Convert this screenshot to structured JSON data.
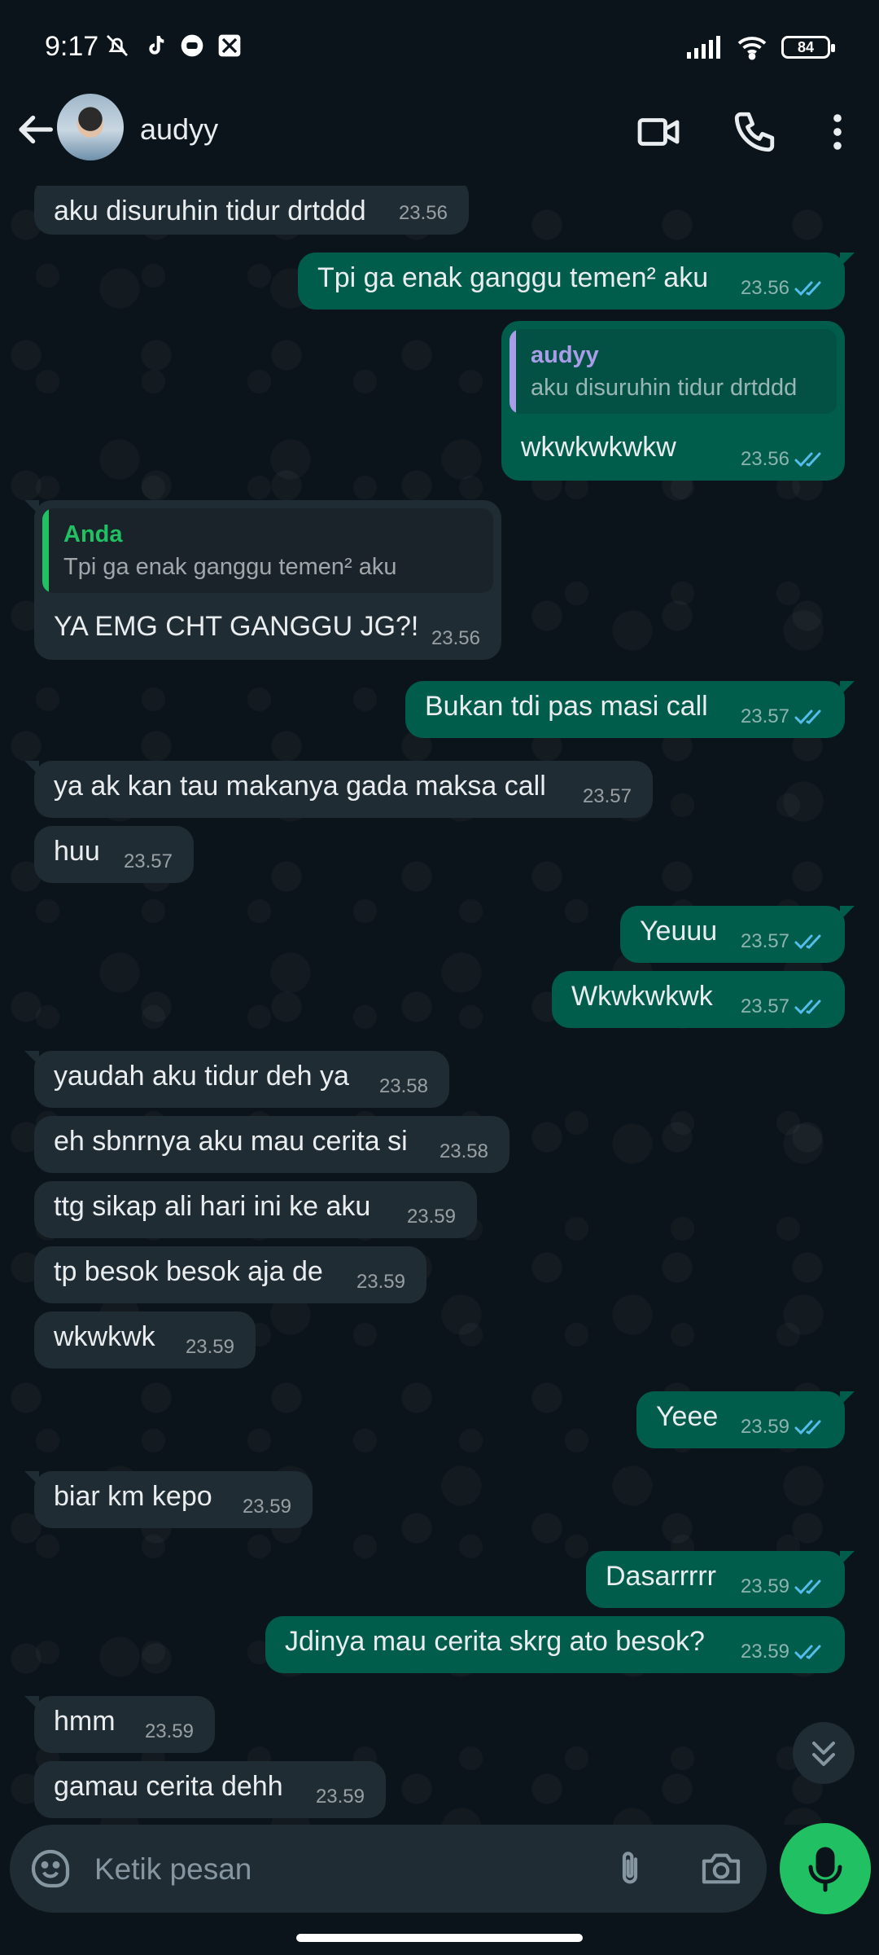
{
  "status_bar": {
    "time": "9:17",
    "battery": "84"
  },
  "header": {
    "contact_name": "audyy"
  },
  "messages": [
    {
      "text": "aku disuruhin tidur drtddd",
      "time": "23.56"
    },
    {
      "text": "Tpi ga enak ganggu temen² aku",
      "time": "23.56"
    },
    {
      "quote_author": "audyy",
      "quote_text": "aku disuruhin tidur drtddd",
      "text": "wkwkwkwkw",
      "time": "23.56"
    },
    {
      "quote_author": "Anda",
      "quote_text": "Tpi ga enak ganggu temen² aku",
      "text": "YA EMG CHT GANGGU JG?!",
      "time": "23.56"
    },
    {
      "text": "Bukan tdi pas masi call",
      "time": "23.57"
    },
    {
      "text": "ya ak kan tau makanya gada maksa call",
      "time": "23.57"
    },
    {
      "text": "huu",
      "time": "23.57"
    },
    {
      "text": "Yeuuu",
      "time": "23.57"
    },
    {
      "text": "Wkwkwkwk",
      "time": "23.57"
    },
    {
      "text": "yaudah aku tidur deh ya",
      "time": "23.58"
    },
    {
      "text": "eh sbnrnya aku mau cerita si",
      "time": "23.58"
    },
    {
      "text": "ttg sikap ali hari ini ke aku",
      "time": "23.59"
    },
    {
      "text": "tp besok besok aja de",
      "time": "23.59"
    },
    {
      "text": "wkwkwk",
      "time": "23.59"
    },
    {
      "text": "Yeee",
      "time": "23.59"
    },
    {
      "text": "biar km kepo",
      "time": "23.59"
    },
    {
      "text": "Dasarrrrr",
      "time": "23.59"
    },
    {
      "text": "Jdinya mau cerita skrg ato besok?",
      "time": "23.59"
    },
    {
      "text": "hmm",
      "time": "23.59"
    },
    {
      "text": "gamau cerita dehh",
      "time": "23.59"
    }
  ],
  "input": {
    "placeholder": "Ketik pesan"
  },
  "colors": {
    "incoming": "#202c33",
    "outgoing": "#005c4b",
    "accent": "#21c063",
    "quote_self": "#a99de8",
    "quote_anda": "#21c063",
    "read_ticks": "#53bdeb"
  },
  "icons": [
    "back-arrow-icon",
    "video-call-icon",
    "voice-call-icon",
    "more-options-icon",
    "double-check-icon",
    "emoji-icon",
    "attach-icon",
    "camera-icon",
    "mic-icon",
    "chevron-double-down-icon"
  ]
}
